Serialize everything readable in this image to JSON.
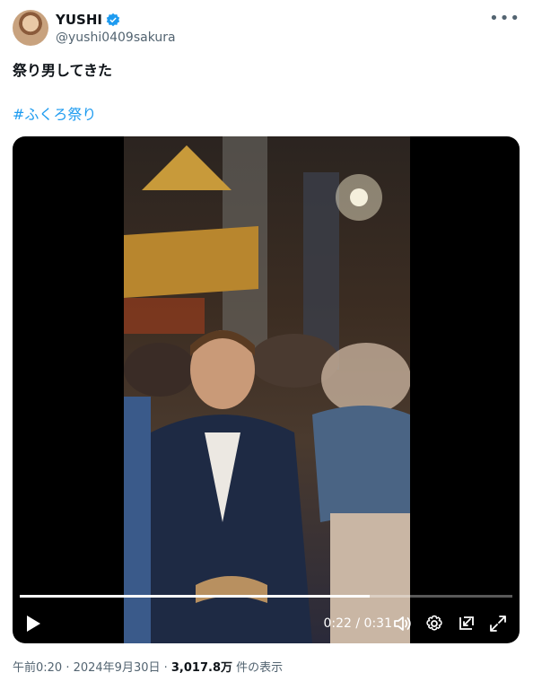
{
  "author": {
    "display_name": "YUSHI",
    "handle": "@yushi0409sakura"
  },
  "post": {
    "text": "祭り男してきた",
    "hashtag": "#ふくろ祭り"
  },
  "video": {
    "current_time": "0:22",
    "duration": "0:31",
    "time_display": "0:22 / 0:31",
    "progress_fraction": 0.71
  },
  "footer": {
    "timestamp": "午前0:20 · 2024年9月30日 · ",
    "views_count": "3,017.8万",
    "views_label": " 件の表示"
  },
  "icons": {
    "verified": "verified-badge-icon",
    "more": "more-options-icon",
    "play": "play-icon",
    "volume": "volume-icon",
    "settings": "settings-gear-icon",
    "pip": "picture-in-picture-icon",
    "fullscreen": "fullscreen-icon"
  },
  "colors": {
    "accent": "#1d9bf0",
    "muted_text": "#536471",
    "primary_text": "#0f1419"
  }
}
